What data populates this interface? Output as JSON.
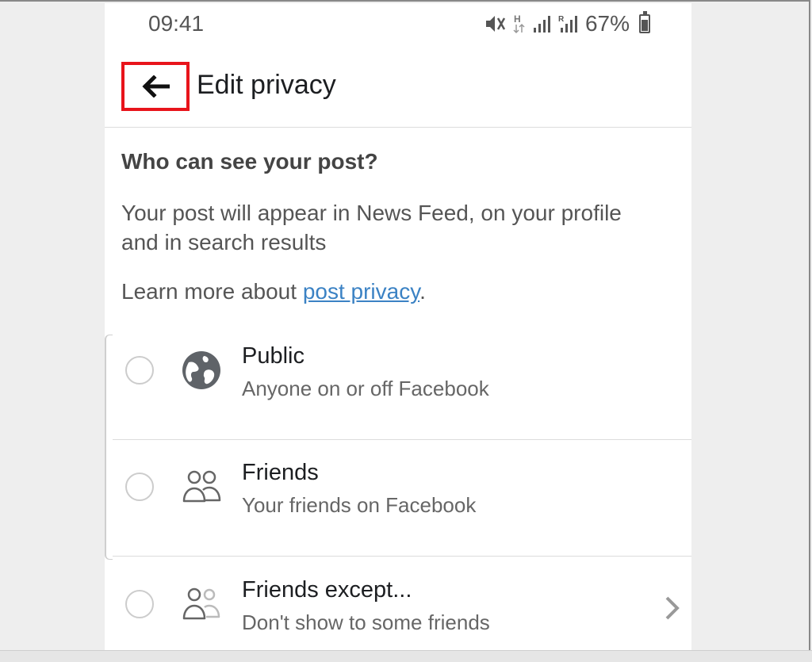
{
  "status_bar": {
    "time": "09:41",
    "battery_percent": "67%",
    "icons": [
      "mute-vibrate-icon",
      "network-h-icon",
      "signal-icon",
      "roaming-signal-icon",
      "battery-icon"
    ]
  },
  "header": {
    "title": "Edit privacy",
    "back_icon": "arrow-left-icon",
    "highlight_color": "#e8141b"
  },
  "content": {
    "question": "Who can see your post?",
    "description": "Your post will appear in News Feed, on your profile and in search results",
    "learn_more_prefix": "Learn more about ",
    "learn_more_link": "post privacy",
    "learn_more_suffix": ".",
    "link_color": "#3b82c4"
  },
  "options": [
    {
      "title": "Public",
      "subtitle": "Anyone on or off Facebook",
      "icon": "globe-icon",
      "selected": false
    },
    {
      "title": "Friends",
      "subtitle": "Your friends on Facebook",
      "icon": "friends-icon",
      "selected": false
    },
    {
      "title": "Friends except...",
      "subtitle": "Don't show to some friends",
      "icon": "friends-except-icon",
      "selected": false,
      "has_chevron": true
    }
  ]
}
